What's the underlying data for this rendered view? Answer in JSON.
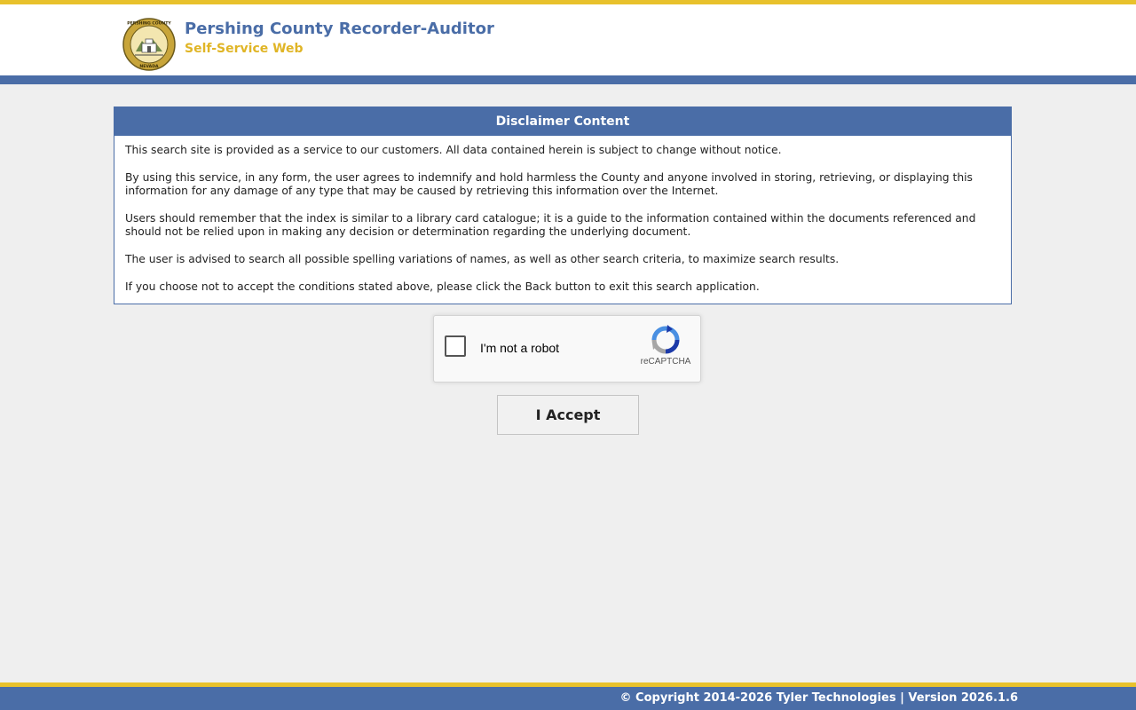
{
  "header": {
    "title": "Pershing County Recorder-Auditor",
    "subtitle": "Self-Service Web",
    "seal_top_text": "PERSHING COUNTY",
    "seal_bottom_text": "NEVADA",
    "accent_color": "#e8c12c",
    "brand_color": "#4a6da7"
  },
  "disclaimer": {
    "heading": "Disclaimer Content",
    "paragraphs": [
      "This search site is provided as a service to our customers. All data contained herein is subject to change without notice.",
      "By using this service, in any form, the user agrees to indemnify and hold harmless the County and anyone involved in storing, retrieving, or displaying this information for any damage of any type that may be caused by retrieving this information over the Internet.",
      "Users should remember that the index is similar to a library card catalogue; it is a guide to the information contained within the documents referenced and should not be relied upon in making any decision or determination regarding the underlying document.",
      "The user is advised to search all possible spelling variations of names, as well as other search criteria, to maximize search results.",
      "If you choose not to accept the conditions stated above, please click the Back button to exit this search application."
    ]
  },
  "captcha": {
    "label": "I'm not a robot",
    "brand": "reCAPTCHA",
    "icon": "recaptcha-logo-icon",
    "checked": false
  },
  "accept_button": {
    "label": "I Accept"
  },
  "footer": {
    "text": "© Copyright 2014-2026 Tyler Technologies | Version 2026.1.6"
  }
}
